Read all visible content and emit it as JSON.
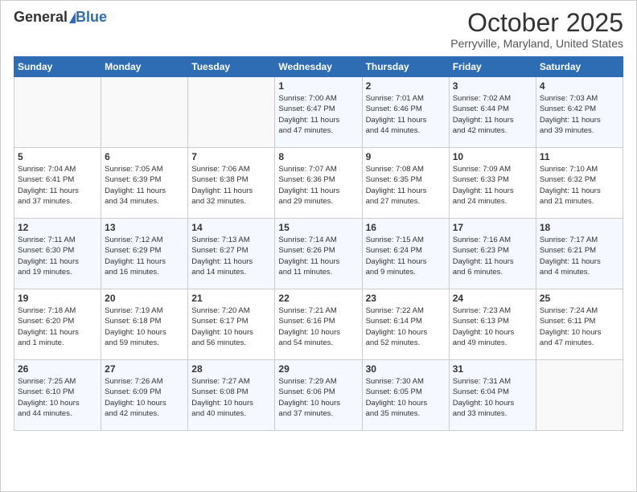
{
  "header": {
    "logo_general": "General",
    "logo_blue": "Blue",
    "title": "October 2025",
    "subtitle": "Perryville, Maryland, United States"
  },
  "days_of_week": [
    "Sunday",
    "Monday",
    "Tuesday",
    "Wednesday",
    "Thursday",
    "Friday",
    "Saturday"
  ],
  "weeks": [
    [
      {
        "num": "",
        "info": ""
      },
      {
        "num": "",
        "info": ""
      },
      {
        "num": "",
        "info": ""
      },
      {
        "num": "1",
        "info": "Sunrise: 7:00 AM\nSunset: 6:47 PM\nDaylight: 11 hours\nand 47 minutes."
      },
      {
        "num": "2",
        "info": "Sunrise: 7:01 AM\nSunset: 6:46 PM\nDaylight: 11 hours\nand 44 minutes."
      },
      {
        "num": "3",
        "info": "Sunrise: 7:02 AM\nSunset: 6:44 PM\nDaylight: 11 hours\nand 42 minutes."
      },
      {
        "num": "4",
        "info": "Sunrise: 7:03 AM\nSunset: 6:42 PM\nDaylight: 11 hours\nand 39 minutes."
      }
    ],
    [
      {
        "num": "5",
        "info": "Sunrise: 7:04 AM\nSunset: 6:41 PM\nDaylight: 11 hours\nand 37 minutes."
      },
      {
        "num": "6",
        "info": "Sunrise: 7:05 AM\nSunset: 6:39 PM\nDaylight: 11 hours\nand 34 minutes."
      },
      {
        "num": "7",
        "info": "Sunrise: 7:06 AM\nSunset: 6:38 PM\nDaylight: 11 hours\nand 32 minutes."
      },
      {
        "num": "8",
        "info": "Sunrise: 7:07 AM\nSunset: 6:36 PM\nDaylight: 11 hours\nand 29 minutes."
      },
      {
        "num": "9",
        "info": "Sunrise: 7:08 AM\nSunset: 6:35 PM\nDaylight: 11 hours\nand 27 minutes."
      },
      {
        "num": "10",
        "info": "Sunrise: 7:09 AM\nSunset: 6:33 PM\nDaylight: 11 hours\nand 24 minutes."
      },
      {
        "num": "11",
        "info": "Sunrise: 7:10 AM\nSunset: 6:32 PM\nDaylight: 11 hours\nand 21 minutes."
      }
    ],
    [
      {
        "num": "12",
        "info": "Sunrise: 7:11 AM\nSunset: 6:30 PM\nDaylight: 11 hours\nand 19 minutes."
      },
      {
        "num": "13",
        "info": "Sunrise: 7:12 AM\nSunset: 6:29 PM\nDaylight: 11 hours\nand 16 minutes."
      },
      {
        "num": "14",
        "info": "Sunrise: 7:13 AM\nSunset: 6:27 PM\nDaylight: 11 hours\nand 14 minutes."
      },
      {
        "num": "15",
        "info": "Sunrise: 7:14 AM\nSunset: 6:26 PM\nDaylight: 11 hours\nand 11 minutes."
      },
      {
        "num": "16",
        "info": "Sunrise: 7:15 AM\nSunset: 6:24 PM\nDaylight: 11 hours\nand 9 minutes."
      },
      {
        "num": "17",
        "info": "Sunrise: 7:16 AM\nSunset: 6:23 PM\nDaylight: 11 hours\nand 6 minutes."
      },
      {
        "num": "18",
        "info": "Sunrise: 7:17 AM\nSunset: 6:21 PM\nDaylight: 11 hours\nand 4 minutes."
      }
    ],
    [
      {
        "num": "19",
        "info": "Sunrise: 7:18 AM\nSunset: 6:20 PM\nDaylight: 11 hours\nand 1 minute."
      },
      {
        "num": "20",
        "info": "Sunrise: 7:19 AM\nSunset: 6:18 PM\nDaylight: 10 hours\nand 59 minutes."
      },
      {
        "num": "21",
        "info": "Sunrise: 7:20 AM\nSunset: 6:17 PM\nDaylight: 10 hours\nand 56 minutes."
      },
      {
        "num": "22",
        "info": "Sunrise: 7:21 AM\nSunset: 6:16 PM\nDaylight: 10 hours\nand 54 minutes."
      },
      {
        "num": "23",
        "info": "Sunrise: 7:22 AM\nSunset: 6:14 PM\nDaylight: 10 hours\nand 52 minutes."
      },
      {
        "num": "24",
        "info": "Sunrise: 7:23 AM\nSunset: 6:13 PM\nDaylight: 10 hours\nand 49 minutes."
      },
      {
        "num": "25",
        "info": "Sunrise: 7:24 AM\nSunset: 6:11 PM\nDaylight: 10 hours\nand 47 minutes."
      }
    ],
    [
      {
        "num": "26",
        "info": "Sunrise: 7:25 AM\nSunset: 6:10 PM\nDaylight: 10 hours\nand 44 minutes."
      },
      {
        "num": "27",
        "info": "Sunrise: 7:26 AM\nSunset: 6:09 PM\nDaylight: 10 hours\nand 42 minutes."
      },
      {
        "num": "28",
        "info": "Sunrise: 7:27 AM\nSunset: 6:08 PM\nDaylight: 10 hours\nand 40 minutes."
      },
      {
        "num": "29",
        "info": "Sunrise: 7:29 AM\nSunset: 6:06 PM\nDaylight: 10 hours\nand 37 minutes."
      },
      {
        "num": "30",
        "info": "Sunrise: 7:30 AM\nSunset: 6:05 PM\nDaylight: 10 hours\nand 35 minutes."
      },
      {
        "num": "31",
        "info": "Sunrise: 7:31 AM\nSunset: 6:04 PM\nDaylight: 10 hours\nand 33 minutes."
      },
      {
        "num": "",
        "info": ""
      }
    ]
  ]
}
